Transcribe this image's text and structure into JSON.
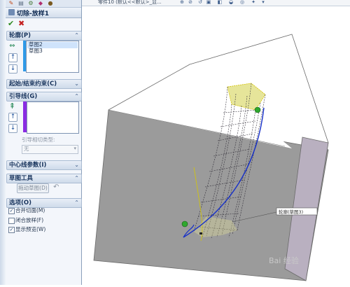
{
  "panel": {
    "title": "切除-放样1",
    "ok_label": "✔",
    "cancel_label": "✖",
    "profiles": {
      "heading": "轮廓(P)",
      "items": [
        "草图2",
        "草图3"
      ]
    },
    "constraints": {
      "heading": "起始/结束约束(C)"
    },
    "guides": {
      "heading": "引导线(G)",
      "tangency_label": "引导相切类型:",
      "tangency_value": "无"
    },
    "centerline": {
      "heading": "中心线参数(I)"
    },
    "sketch_tools": {
      "heading": "草图工具",
      "drag_sketch_label": "拖动草图(D)"
    },
    "options": {
      "heading": "选项(O)",
      "items": [
        {
          "label": "合并切面(M)",
          "checked": true
        },
        {
          "label": "闭合放样(F)",
          "checked": false
        },
        {
          "label": "显示预览(W)",
          "checked": true
        }
      ]
    }
  },
  "toolbar": {
    "doc_title": "零件10 (默认<<默认>_显..."
  },
  "viewport": {
    "callout_label": "轮廓(草图3)"
  },
  "watermark": "Bai 经验"
}
